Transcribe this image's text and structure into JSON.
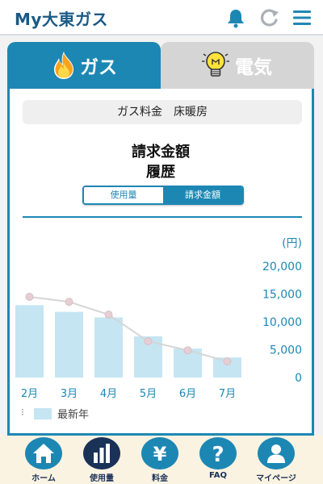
{
  "app": {
    "title": "My大東ガス"
  },
  "tabs": [
    {
      "label": "ガス",
      "icon": "flame-icon",
      "active": true
    },
    {
      "label": "電気",
      "icon": "lightbulb-icon",
      "active": false
    }
  ],
  "card": {
    "subtitle": "ガス料金　床暖房",
    "heading_line1": "請求金額",
    "heading_line2": "履歴",
    "segmented": {
      "usage_label": "使用量",
      "bill_label": "請求金額",
      "selected": "請求金額"
    }
  },
  "legend": {
    "dots": "⁝",
    "label": "最新年"
  },
  "colors": {
    "accent": "#1d87b4",
    "bar": "#c5e5f3",
    "line": "#d6d6d6",
    "nav_active": "#1a3158",
    "nav_bg": "#fbf3e1"
  },
  "chart_data": {
    "type": "bar",
    "categories": [
      "2月",
      "3月",
      "4月",
      "5月",
      "6月",
      "7月"
    ],
    "series": [
      {
        "name": "最新年",
        "type": "bar",
        "values": [
          13000,
          11800,
          10800,
          7400,
          5200,
          3600
        ]
      },
      {
        "type": "line",
        "values": [
          14500,
          13600,
          11300,
          6500,
          4900,
          2900
        ]
      }
    ],
    "ylabel": "(円)",
    "ylim": [
      0,
      20000
    ],
    "yticks": [
      "0",
      "5,000",
      "10,000",
      "15,000",
      "20,000"
    ],
    "ytick_values": [
      0,
      5000,
      10000,
      15000,
      20000
    ],
    "y_axis_position": "right",
    "grid": false
  },
  "nav": [
    {
      "label": "ホーム",
      "icon": "home-icon",
      "active": false
    },
    {
      "label": "使用量",
      "icon": "bar-chart-icon",
      "active": true
    },
    {
      "label": "料金",
      "icon": "yen-icon",
      "active": false
    },
    {
      "label": "FAQ",
      "icon": "question-icon",
      "active": false
    },
    {
      "label": "マイページ",
      "icon": "user-icon",
      "active": false
    }
  ]
}
